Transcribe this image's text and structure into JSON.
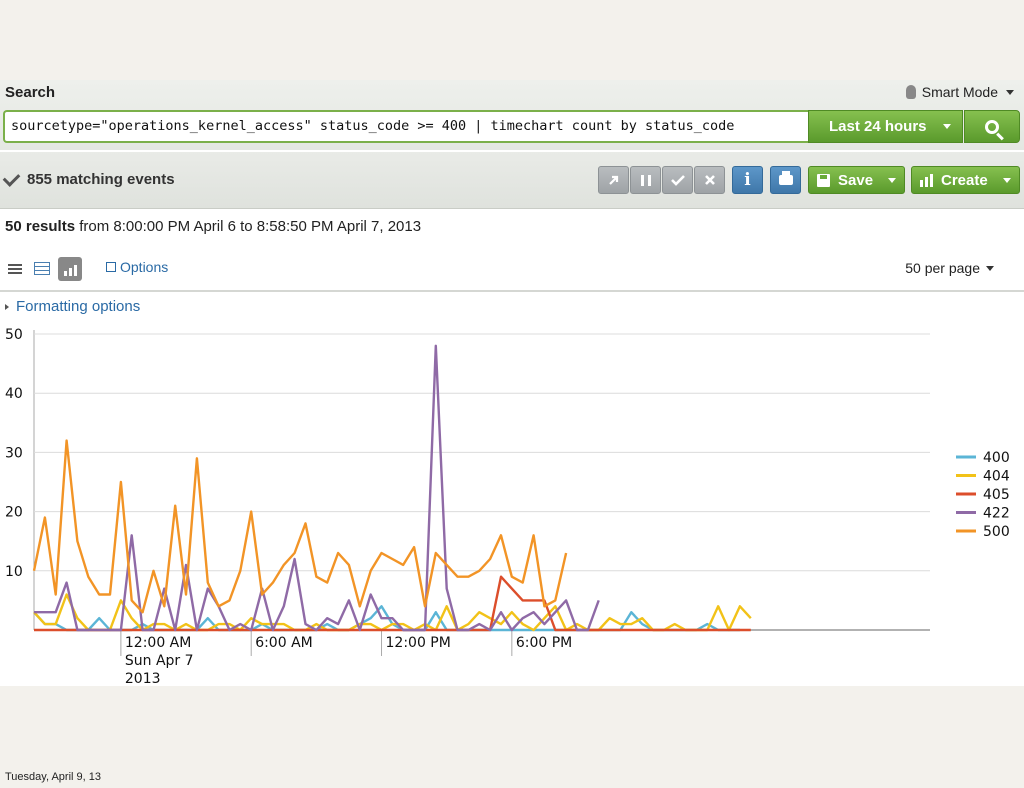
{
  "search_header": {
    "title": "Search",
    "mode_label": "Smart Mode",
    "query": "sourcetype=\"operations_kernel_access\" status_code >= 400 | timechart count by status_code",
    "time_range": "Last 24 hours"
  },
  "toolbar": {
    "match_count": "855 matching events",
    "save_label": "Save",
    "create_label": "Create",
    "info_label": "i"
  },
  "results": {
    "count": "50 results",
    "range": "from 8:00:00 PM April 6 to 8:58:50 PM April 7, 2013"
  },
  "view_bar": {
    "options_label": "Options",
    "per_page": "50 per page"
  },
  "formatting_label": "Formatting options",
  "footer_date": "Tuesday, April 9, 13",
  "colors": {
    "accent_green": "#6aab38",
    "link_blue": "#2a6aa5",
    "series_400": "#5bb5d6",
    "series_404": "#f2c218",
    "series_405": "#dc4e2b",
    "series_422": "#8f6aa6",
    "series_500": "#f29426"
  },
  "chart_data": {
    "type": "line",
    "x_tick_labels": [
      [
        "12:00 AM",
        "Sun Apr 7",
        "2013"
      ],
      [
        "6:00 AM"
      ],
      [
        "12:00 PM"
      ],
      [
        "6:00 PM"
      ]
    ],
    "x_tick_hours": [
      4,
      10,
      16,
      22
    ],
    "x_start_label": "8:00 PM April 6",
    "x_interval_minutes": 30,
    "ylim": [
      0,
      50
    ],
    "y_ticks": [
      10,
      20,
      30,
      40,
      50
    ],
    "grid": true,
    "legend_position": "right",
    "series": [
      {
        "name": "400",
        "color": "#5bb5d6",
        "values": [
          3,
          1,
          1,
          0,
          0,
          0,
          2,
          0,
          0,
          0,
          1,
          0,
          0,
          0,
          0,
          0,
          2,
          0,
          0,
          0,
          0,
          1,
          0,
          0,
          0,
          0,
          0,
          1,
          0,
          0,
          1,
          2,
          4,
          1,
          0,
          0,
          0,
          3,
          0,
          0,
          0,
          0,
          0,
          0,
          0,
          0,
          0,
          0,
          0,
          0,
          0,
          0,
          0,
          0,
          0,
          3,
          1,
          0,
          0,
          0,
          0,
          0,
          1,
          0,
          0,
          0
        ]
      },
      {
        "name": "404",
        "color": "#f2c218",
        "values": [
          3,
          1,
          1,
          6,
          2,
          0,
          0,
          0,
          5,
          2,
          0,
          1,
          1,
          0,
          1,
          0,
          0,
          1,
          1,
          0,
          2,
          1,
          1,
          1,
          0,
          0,
          1,
          0,
          0,
          0,
          1,
          1,
          0,
          1,
          1,
          0,
          1,
          0,
          4,
          0,
          1,
          3,
          2,
          1,
          3,
          1,
          0,
          2,
          4,
          0,
          1,
          0,
          0,
          2,
          1,
          1,
          2,
          0,
          0,
          1,
          0,
          0,
          0,
          4,
          0,
          4,
          2
        ]
      },
      {
        "name": "405",
        "color": "#dc4e2b",
        "values": [
          0,
          0,
          0,
          0,
          0,
          0,
          0,
          0,
          0,
          0,
          0,
          0,
          0,
          0,
          0,
          0,
          0,
          0,
          0,
          0,
          0,
          0,
          0,
          0,
          0,
          0,
          0,
          0,
          0,
          0,
          0,
          0,
          0,
          0,
          0,
          0,
          0,
          0,
          0,
          0,
          0,
          0,
          0,
          9,
          7,
          5,
          5,
          5,
          0,
          0,
          0,
          0,
          0,
          0,
          0,
          0,
          0,
          0,
          0,
          0,
          0,
          0,
          0,
          0,
          0,
          0,
          0
        ]
      },
      {
        "name": "422",
        "color": "#8f6aa6",
        "values": [
          3,
          3,
          3,
          8,
          0,
          0,
          0,
          0,
          0,
          16,
          0,
          0,
          7,
          0,
          11,
          0,
          7,
          4,
          0,
          1,
          0,
          7,
          0,
          4,
          12,
          1,
          0,
          2,
          1,
          5,
          0,
          6,
          2,
          2,
          0,
          0,
          0,
          48,
          7,
          0,
          0,
          1,
          0,
          3,
          0,
          2,
          3,
          1,
          3,
          5,
          0,
          0,
          5
        ]
      },
      {
        "name": "500",
        "color": "#f29426",
        "values": [
          10,
          19,
          6,
          32,
          15,
          9,
          6,
          6,
          25,
          5,
          3,
          10,
          4,
          21,
          6,
          29,
          8,
          4,
          5,
          10,
          20,
          6,
          8,
          11,
          13,
          18,
          9,
          8,
          13,
          11,
          4,
          10,
          13,
          12,
          11,
          14,
          4,
          13,
          11,
          9,
          9,
          10,
          12,
          16,
          9,
          8,
          16,
          4,
          5,
          13
        ]
      }
    ]
  }
}
